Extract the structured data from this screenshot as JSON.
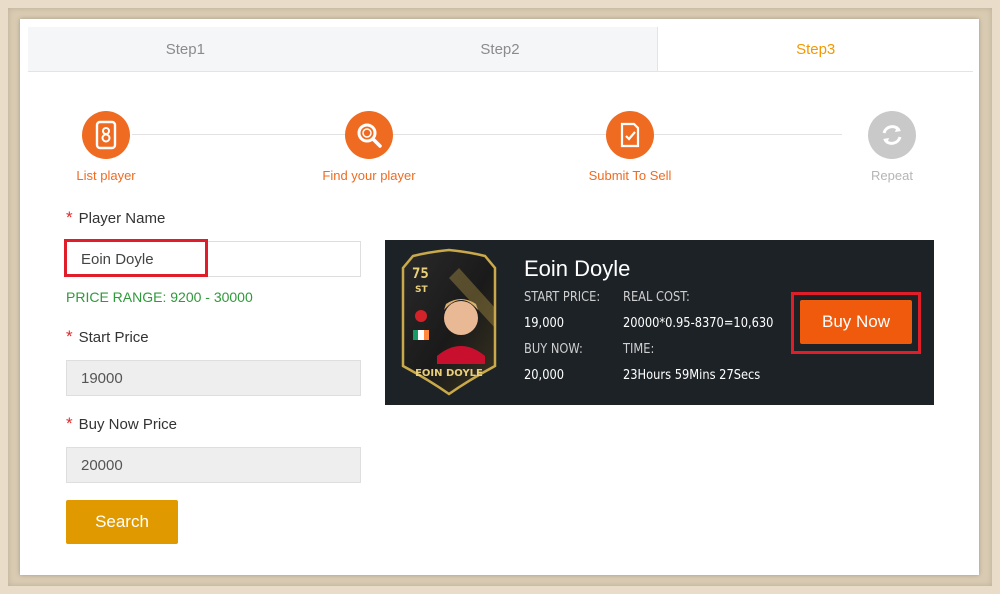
{
  "tabs": [
    {
      "label": "Step1",
      "active": false
    },
    {
      "label": "Step2",
      "active": false
    },
    {
      "label": "Step3",
      "active": true
    }
  ],
  "stepper": [
    {
      "label": "List player",
      "icon": "list-player-icon",
      "state": "done"
    },
    {
      "label": "Find your player",
      "icon": "search-icon",
      "state": "done"
    },
    {
      "label": "Submit To Sell",
      "icon": "submit-icon",
      "state": "done"
    },
    {
      "label": "Repeat",
      "icon": "repeat-icon",
      "state": "pending"
    }
  ],
  "form": {
    "player_name_label": "Player Name",
    "player_name_value": "Eoin Doyle",
    "price_range": "PRICE RANGE: 9200 - 30000",
    "start_price_label": "Start Price",
    "start_price_value": "19000",
    "buy_now_label": "Buy Now Price",
    "buy_now_value": "20000",
    "search_label": "Search",
    "required_mark": "*"
  },
  "player": {
    "name": "Eoin Doyle",
    "start_price_label": "START PRICE:",
    "start_price": "19,000",
    "buy_now_label": "BUY NOW:",
    "buy_now": "20,000",
    "real_cost_label": "REAL COST:",
    "real_cost": "20000*0.95-8370=10,630",
    "time_label": "TIME:",
    "time": "23Hours 59Mins 27Secs",
    "buy_button": "Buy Now",
    "card": {
      "rating": "75",
      "position": "ST",
      "name": "EOIN DOYLE"
    }
  },
  "colors": {
    "accent": "#ef6b22",
    "active_tab": "#f39800",
    "search_button": "#e09a00",
    "buy_button": "#ef5a0c",
    "price_range": "#2e9a3a",
    "highlight": "#e01e2a"
  }
}
